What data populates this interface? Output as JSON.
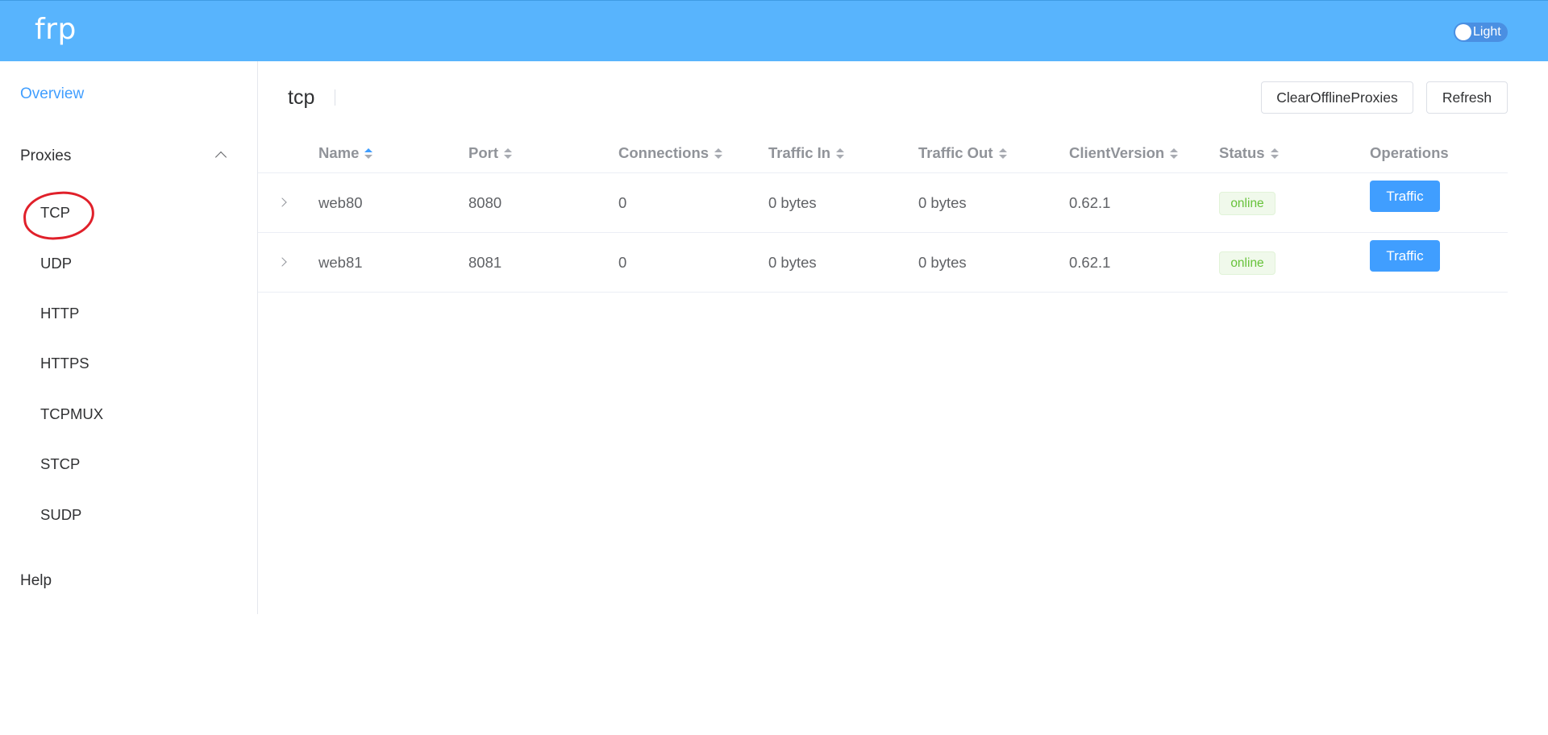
{
  "app": {
    "brand": "frp",
    "theme_label": "Light"
  },
  "sidebar": {
    "overview": "Overview",
    "proxies": "Proxies",
    "items": [
      "TCP",
      "UDP",
      "HTTP",
      "HTTPS",
      "TCPMUX",
      "STCP",
      "SUDP"
    ],
    "help": "Help"
  },
  "page": {
    "title": "tcp",
    "clear_button": "ClearOfflineProxies",
    "refresh_button": "Refresh"
  },
  "table": {
    "columns": [
      "Name",
      "Port",
      "Connections",
      "Traffic In",
      "Traffic Out",
      "ClientVersion",
      "Status",
      "Operations"
    ],
    "rows": [
      {
        "name": "web80",
        "port": "8080",
        "connections": "0",
        "traffic_in": "0 bytes",
        "traffic_out": "0 bytes",
        "client_version": "0.62.1",
        "status": "online",
        "operation": "Traffic"
      },
      {
        "name": "web81",
        "port": "8081",
        "connections": "0",
        "traffic_in": "0 bytes",
        "traffic_out": "0 bytes",
        "client_version": "0.62.1",
        "status": "online",
        "operation": "Traffic"
      }
    ]
  },
  "colors": {
    "header": "#58b4fd",
    "accent": "#409eff",
    "online": "#67c23a",
    "annotation": "#e0202a"
  }
}
